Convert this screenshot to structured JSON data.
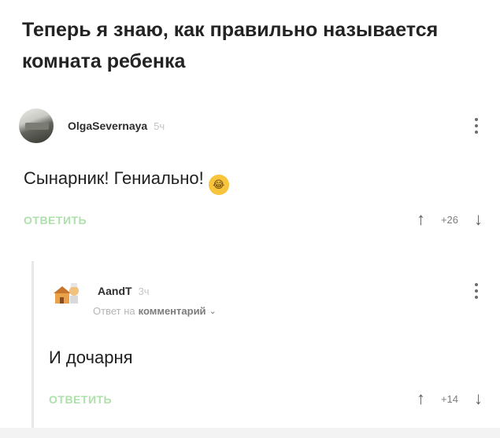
{
  "post": {
    "title": "Теперь я знаю, как правильно называется комната ребенка"
  },
  "comments": [
    {
      "author": "OlgaSevernaya",
      "time": "5ч",
      "text": "Сынарник! Гениально!",
      "emoji": "😂",
      "reply_label": "ОТВЕТИТЬ",
      "rating": "+26",
      "avatar_icon": "user-avatar"
    },
    {
      "author": "AandT",
      "time": "3ч",
      "reply_to_prefix": "Ответ на",
      "reply_to_target": "комментарий",
      "text": "И дочарня",
      "reply_label": "ОТВЕТИТЬ",
      "rating": "+14",
      "avatar_icon": "user-avatar"
    }
  ],
  "icons": {
    "menu": "more-vertical-icon",
    "upvote": "arrow-up-icon",
    "downvote": "arrow-down-icon",
    "expand": "chevron-down-icon"
  },
  "colors": {
    "reply_button": "#aee0ac",
    "text": "#202020",
    "muted": "#b5b5b5"
  }
}
